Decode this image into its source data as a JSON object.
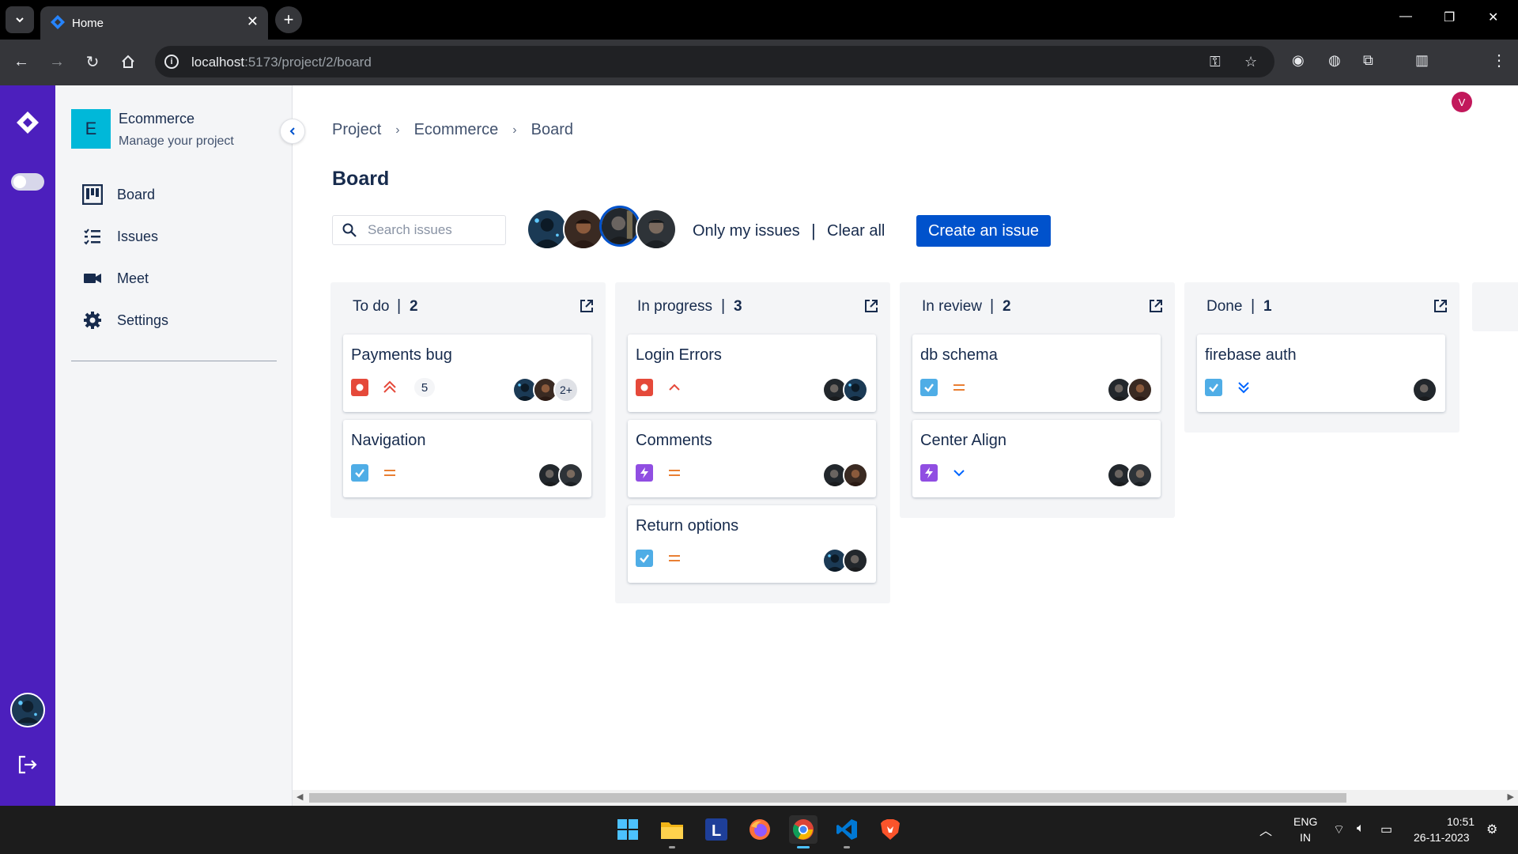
{
  "browser": {
    "tab_title": "Home",
    "url_host": "localhost",
    "url_rest": ":5173/project/2/board",
    "profile_initial": "V"
  },
  "project": {
    "initial": "E",
    "name": "Ecommerce",
    "subtitle": "Manage your project"
  },
  "sidebar": {
    "items": [
      {
        "label": "Board",
        "icon": "board-icon"
      },
      {
        "label": "Issues",
        "icon": "issues-list-icon"
      },
      {
        "label": "Meet",
        "icon": "video-camera-icon"
      },
      {
        "label": "Settings",
        "icon": "gear-icon"
      }
    ]
  },
  "breadcrumb": [
    "Project",
    "Ecommerce",
    "Board"
  ],
  "page_title": "Board",
  "search": {
    "placeholder": "Search issues",
    "value": ""
  },
  "filters": {
    "only_my_issues": "Only my issues",
    "clear_all": "Clear all"
  },
  "create_button": "Create an issue",
  "colors": {
    "rail": "#4c1fbd",
    "primary": "#0052cc",
    "bug": "#e5493a",
    "task": "#4fade6",
    "story": "#904ee2",
    "prio_high": "#e5493a",
    "prio_medium": "#e97f33",
    "prio_low": "#2d8738",
    "prio_lowest": "#0065ff"
  },
  "columns": [
    {
      "title": "To do",
      "count": "2",
      "cards": [
        {
          "title": "Payments bug",
          "type": "bug",
          "priority": "highest",
          "estimate": "5",
          "assignees": 2,
          "more": "2+"
        },
        {
          "title": "Navigation",
          "type": "task",
          "priority": "medium",
          "estimate": "",
          "assignees": 2,
          "more": ""
        }
      ]
    },
    {
      "title": "In progress",
      "count": "3",
      "cards": [
        {
          "title": "Login Errors",
          "type": "bug",
          "priority": "high",
          "estimate": "",
          "assignees": 2,
          "more": ""
        },
        {
          "title": "Comments",
          "type": "story",
          "priority": "medium",
          "estimate": "",
          "assignees": 2,
          "more": ""
        },
        {
          "title": "Return options",
          "type": "task",
          "priority": "medium",
          "estimate": "",
          "assignees": 2,
          "more": ""
        }
      ]
    },
    {
      "title": "In review",
      "count": "2",
      "cards": [
        {
          "title": "db schema",
          "type": "task",
          "priority": "medium",
          "estimate": "",
          "assignees": 2,
          "more": ""
        },
        {
          "title": "Center Align",
          "type": "story",
          "priority": "low",
          "estimate": "",
          "assignees": 2,
          "more": ""
        }
      ]
    },
    {
      "title": "Done",
      "count": "1",
      "cards": [
        {
          "title": "firebase auth",
          "type": "task",
          "priority": "lowest",
          "estimate": "",
          "assignees": 1,
          "more": ""
        }
      ]
    }
  ],
  "taskbar": {
    "apps": [
      "windows-start-icon",
      "file-explorer-icon",
      "lens-app-icon",
      "firefox-icon",
      "chrome-icon",
      "vscode-icon",
      "brave-icon"
    ],
    "lang_top": "ENG",
    "lang_bottom": "IN",
    "time": "10:51",
    "date": "26-11-2023"
  }
}
